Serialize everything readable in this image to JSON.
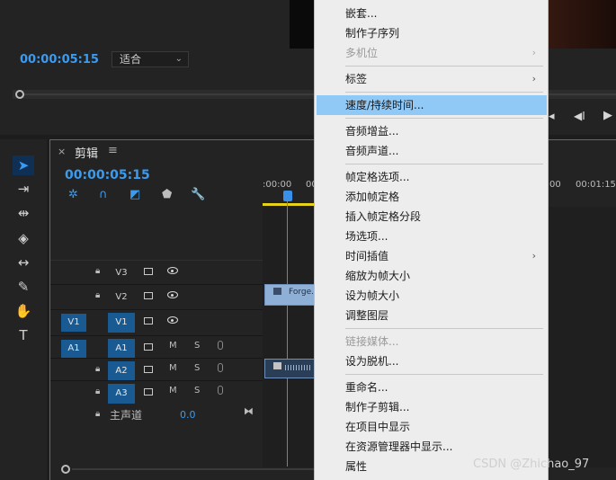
{
  "monitor": {
    "timecode": "00:00:05:15",
    "fit_value": "适合"
  },
  "timeline": {
    "close_glyph": "×",
    "title": "剪辑",
    "menu_glyph": "≡",
    "timecode": "00:00:05:15",
    "ruler": [
      ":00:00",
      "00",
      "00",
      "00:01:15"
    ],
    "tracks": [
      {
        "name": "V3",
        "src": ""
      },
      {
        "name": "V2",
        "src": ""
      },
      {
        "name": "V1",
        "src": "V1"
      },
      {
        "name": "A1",
        "src": "A1"
      },
      {
        "name": "A2",
        "src": ""
      },
      {
        "name": "A3",
        "src": ""
      }
    ],
    "mute_label": "M",
    "solo_label": "S",
    "master_label": "主声道",
    "master_volume": "0.0",
    "clip_v2_label": "Forge.a"
  },
  "menu": {
    "items": [
      {
        "label": "嵌套...",
        "state": "normal"
      },
      {
        "label": "制作子序列",
        "state": "normal"
      },
      {
        "label": "多机位",
        "state": "disabled",
        "submenu": "›"
      },
      {
        "label": "标签",
        "state": "normal",
        "submenu": "›"
      },
      {
        "label": "速度/持续时间...",
        "state": "highlighted"
      },
      {
        "label": "音频增益...",
        "state": "normal"
      },
      {
        "label": "音频声道...",
        "state": "normal"
      },
      {
        "label": "帧定格选项...",
        "state": "normal"
      },
      {
        "label": "添加帧定格",
        "state": "normal"
      },
      {
        "label": "插入帧定格分段",
        "state": "normal"
      },
      {
        "label": "场选项...",
        "state": "normal"
      },
      {
        "label": "时间插值",
        "state": "normal",
        "submenu": "›"
      },
      {
        "label": "缩放为帧大小",
        "state": "normal"
      },
      {
        "label": "设为帧大小",
        "state": "normal"
      },
      {
        "label": "调整图层",
        "state": "normal"
      },
      {
        "label": "链接媒体...",
        "state": "disabled"
      },
      {
        "label": "设为脱机...",
        "state": "normal"
      },
      {
        "label": "重命名...",
        "state": "normal"
      },
      {
        "label": "制作子剪辑...",
        "state": "normal"
      },
      {
        "label": "在项目中显示",
        "state": "normal"
      },
      {
        "label": "在资源管理器中显示...",
        "state": "normal"
      },
      {
        "label": "属性",
        "state": "normal"
      }
    ]
  },
  "watermark": "CSDN @Zhichao_97",
  "colors": {
    "accent_blue": "#3a9bf0",
    "track_target": "#1a5a93",
    "menu_highlight": "#90c8f6",
    "work_area": "#e6d21a"
  }
}
